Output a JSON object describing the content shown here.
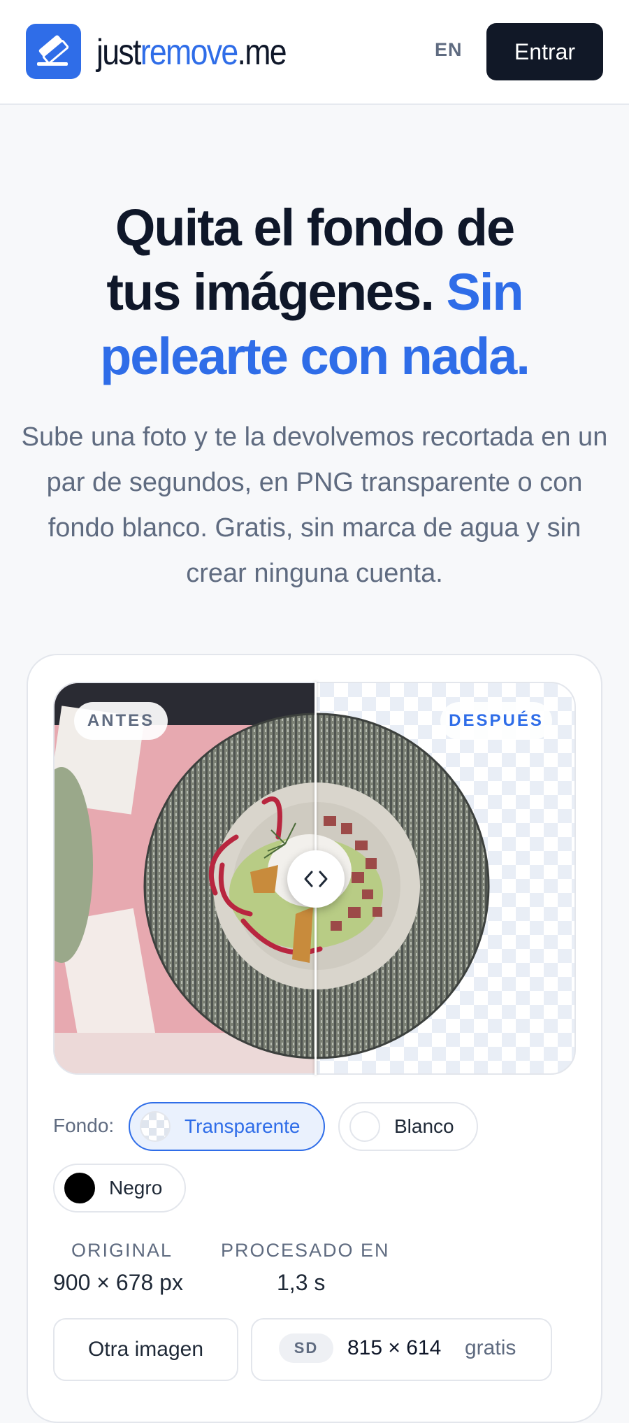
{
  "header": {
    "brand_part1": "just",
    "brand_part2": "remove",
    "brand_part3": ".me",
    "lang_label": "EN",
    "login_label": "Entrar"
  },
  "hero": {
    "title_line1": "Quita el fondo de",
    "title_line2": "tus imágenes.",
    "title_accent_line2": "Sin",
    "title_accent_line3": "pelearte con nada.",
    "subtitle": "Sube una foto y te la devolvemos recortada en un par de segundos, en PNG transparente o con fondo blanco. Gratis, sin marca de agua y sin crear ninguna cuenta."
  },
  "compare": {
    "before_label": "ANTES",
    "after_label": "DESPUÉS",
    "divider_position": 0.5
  },
  "background": {
    "label": "Fondo:",
    "options": [
      {
        "label": "Transparente",
        "selected": true
      },
      {
        "label": "Blanco",
        "selected": false
      },
      {
        "label": "Negro",
        "selected": false
      }
    ]
  },
  "stats": {
    "original_label": "ORIGINAL",
    "original_value": "900 × 678 px",
    "processed_label": "PROCESADO EN",
    "processed_value": "1,3 s"
  },
  "actions": {
    "other_image_label": "Otra imagen",
    "quality_badge": "SD",
    "download_size": "815 × 614",
    "download_price": "gratis"
  },
  "colors": {
    "accent": "#2f6de8",
    "dark": "#111827",
    "muted": "#5f6b80"
  }
}
